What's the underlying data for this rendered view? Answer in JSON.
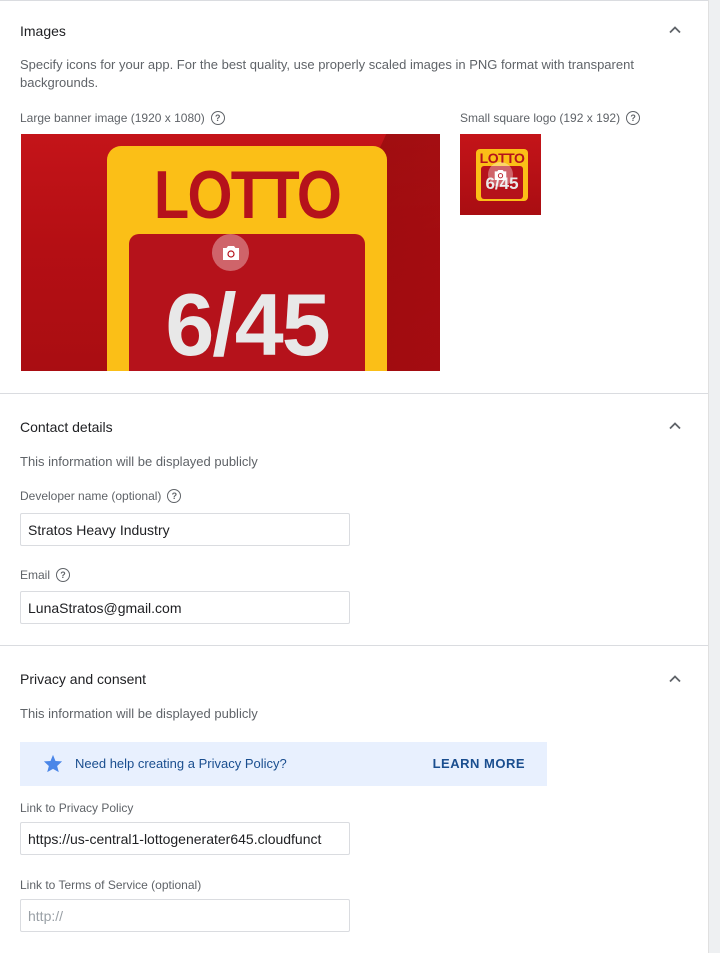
{
  "images": {
    "title": "Images",
    "description": "Specify icons for your app. For the best quality, use properly scaled images in PNG format with transparent backgrounds.",
    "banner_label": "Large banner image (1920 x 1080)",
    "logo_label": "Small square logo (192 x 192)",
    "artwork_top": "LOTTO",
    "artwork_number": "6/45"
  },
  "contact": {
    "title": "Contact details",
    "description": "This information will be displayed publicly",
    "developer_label": "Developer name (optional)",
    "developer_value": "Stratos Heavy Industry",
    "email_label": "Email",
    "email_value": "LunaStratos@gmail.com"
  },
  "privacy": {
    "title": "Privacy and consent",
    "description": "This information will be displayed publicly",
    "help_text": "Need help creating a Privacy Policy?",
    "learn_more": "LEARN MORE",
    "policy_label": "Link to Privacy Policy",
    "policy_value": "https://us-central1-lottogenerater645.cloudfunct",
    "tos_label": "Link to Terms of Service (optional)",
    "tos_placeholder": "http://"
  },
  "icons": {
    "collapse": "chevron-up-icon",
    "help": "help-circle-icon",
    "camera": "camera-icon",
    "star": "star-icon"
  },
  "colors": {
    "accent_blue": "#1a4e8f",
    "info_background": "#e8f0fe",
    "divider": "#dadce0",
    "banner_red": "#b5121b",
    "banner_yellow": "#fbbf17"
  }
}
